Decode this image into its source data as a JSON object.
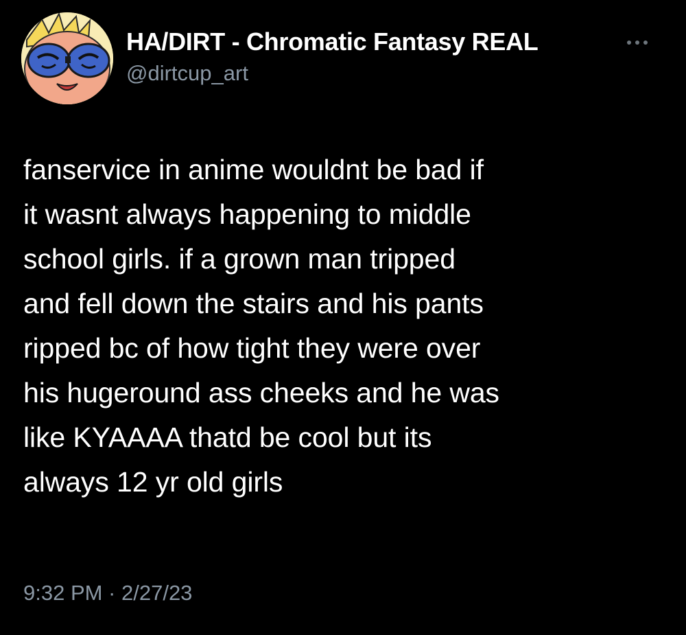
{
  "author": {
    "display_name": "HA/DIRT - Chromatic Fantasy REAL",
    "handle": "@dirtcup_art",
    "avatar_icon": "cartoon-face-avatar-icon"
  },
  "tweet": {
    "lines": [
      "fanservice in anime wouldnt be bad if",
      "it wasnt always happening to middle",
      "school girls. if a grown man tripped",
      "and fell down the stairs and his pants",
      "ripped bc of how tight they were over",
      "his hugeround ass cheeks and he was",
      "like KYAAAA thatd be cool but its",
      "always 12 yr old girls"
    ],
    "timestamp": "9:32 PM · 2/27/23"
  },
  "menu": {
    "icon": "more-options-icon"
  },
  "colors": {
    "background": "#000000",
    "primary_text": "#ffffff",
    "secondary_text": "#8b98a5"
  }
}
